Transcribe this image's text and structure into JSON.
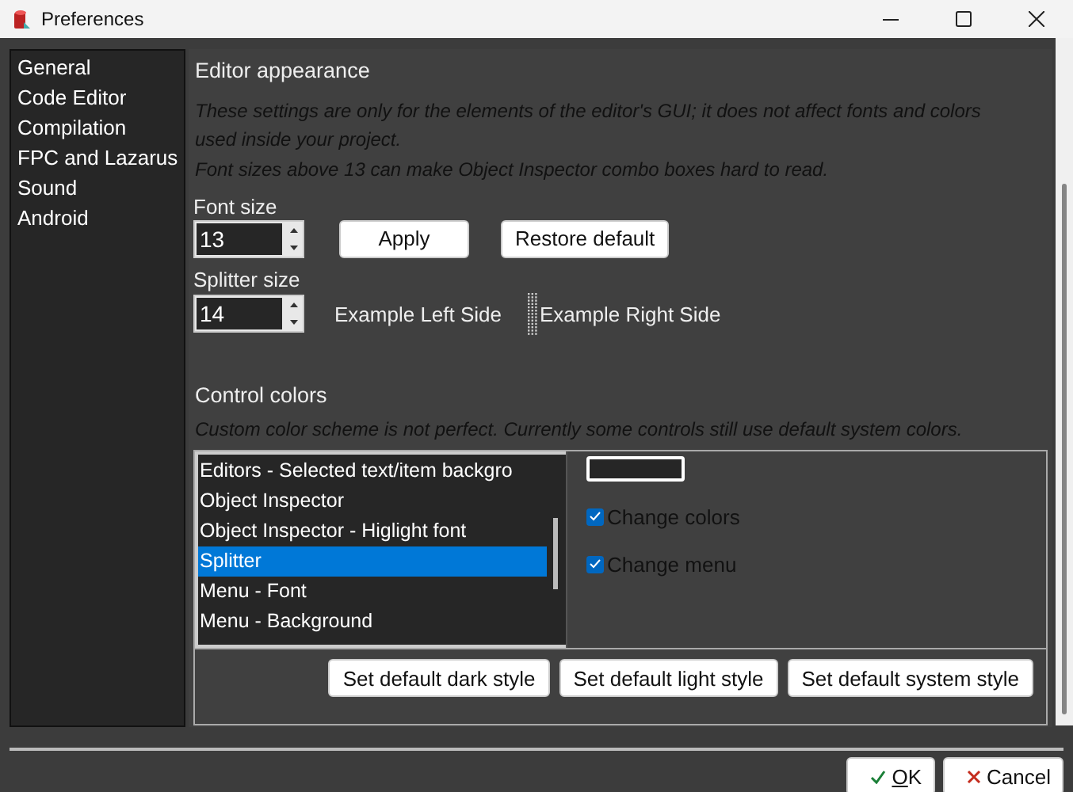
{
  "window": {
    "title": "Preferences"
  },
  "sidebar": {
    "items": [
      {
        "label": "General",
        "selected": false
      },
      {
        "label": "Code Editor",
        "selected": false
      },
      {
        "label": "Compilation",
        "selected": false
      },
      {
        "label": "FPC and Lazarus",
        "selected": false
      },
      {
        "label": "Sound",
        "selected": false
      },
      {
        "label": "Android",
        "selected": false
      }
    ]
  },
  "editor_appearance": {
    "heading": "Editor appearance",
    "notes": [
      "These settings are only for the elements of the editor's GUI; it does not affect fonts and colors used inside your project.",
      "Font sizes above 13 can make Object Inspector combo boxes hard to read."
    ],
    "font_size": {
      "label": "Font size",
      "value": "13"
    },
    "splitter_size": {
      "label": "Splitter size",
      "value": "14"
    },
    "apply_button": "Apply",
    "restore_button": "Restore default",
    "example_left": "Example Left Side",
    "example_right": "Example Right Side"
  },
  "control_colors": {
    "heading": "Control colors",
    "note": "Custom color scheme is not perfect. Currently some controls still use default system colors.",
    "items": [
      {
        "label": "Editors - Selected text/item backgro",
        "selected": false
      },
      {
        "label": "Object Inspector",
        "selected": false
      },
      {
        "label": "Object Inspector - Higlight font",
        "selected": false
      },
      {
        "label": "Splitter",
        "selected": true
      },
      {
        "label": "Menu - Font",
        "selected": false
      },
      {
        "label": "Menu - Background",
        "selected": false
      }
    ],
    "checkboxes": [
      {
        "label": "Change colors",
        "checked": true
      },
      {
        "label": "Change menu",
        "checked": true
      }
    ],
    "buttons": [
      "Set default dark style",
      "Set default light style",
      "Set default system style"
    ]
  },
  "buttons": [
    {
      "label": "OK",
      "kind": "ok"
    },
    {
      "label": "Cancel",
      "kind": "cancel"
    }
  ]
}
